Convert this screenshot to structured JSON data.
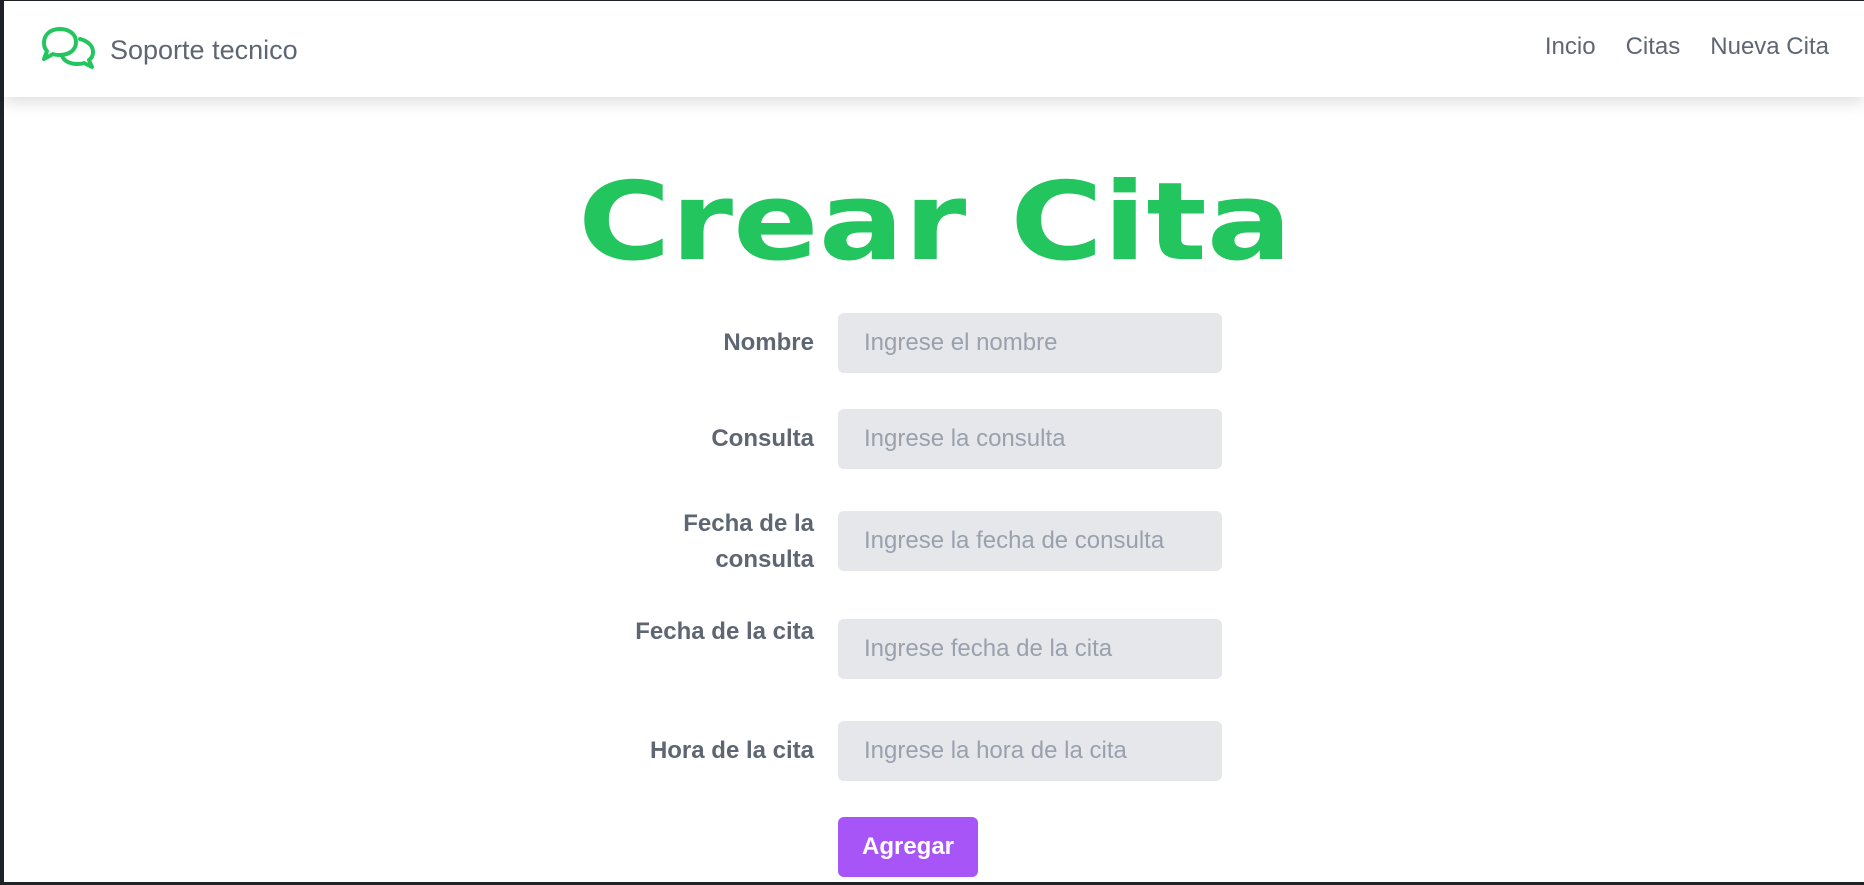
{
  "navbar": {
    "brand": {
      "icon": "chat-bubbles-icon",
      "text": "Soporte tecnico"
    },
    "links": [
      "Incio",
      "Citas",
      "Nueva Cita"
    ]
  },
  "page": {
    "title": "Crear Cita"
  },
  "form": {
    "fields": [
      {
        "label": "Nombre",
        "placeholder": "Ingrese el nombre",
        "value": ""
      },
      {
        "label": "Consulta",
        "placeholder": "Ingrese la consulta",
        "value": ""
      },
      {
        "label": "Fecha de la consulta",
        "placeholder": "Ingrese la fecha de consulta",
        "value": ""
      },
      {
        "label": "Fecha de la cita",
        "placeholder": "Ingrese fecha de la cita",
        "value": ""
      },
      {
        "label": "Hora de la cita",
        "placeholder": "Ingrese la hora de la cita",
        "value": ""
      }
    ],
    "submit_label": "Agregar"
  },
  "colors": {
    "brand_green": "#22c55e",
    "button_purple": "#a855f7",
    "text_gray": "#5f6673",
    "input_bg": "#e5e7eb"
  }
}
